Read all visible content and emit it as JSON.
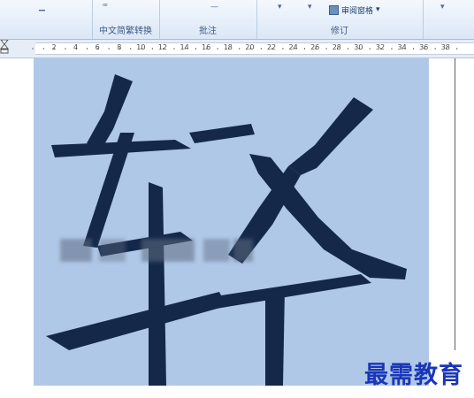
{
  "ribbon": {
    "groups": [
      {
        "id": "chinese",
        "label": "中文简繁转换"
      },
      {
        "id": "comments",
        "label": "批注"
      },
      {
        "id": "tracking",
        "label": "修订"
      }
    ],
    "tracking_button_label": "审阅窗格",
    "tracking_button_arrow": "▾"
  },
  "ruler": {
    "ticks": [
      "2",
      "4",
      "6",
      "8",
      "10",
      "12",
      "14",
      "16",
      "18",
      "20",
      "22",
      "24",
      "26",
      "28",
      "30",
      "32",
      "34",
      "36",
      "38"
    ]
  },
  "document": {
    "character": "轻"
  },
  "watermark": "最需教育",
  "colors": {
    "page_background": "#b0c8e8",
    "character_fill": "#14284a",
    "watermark": "#1a36b8"
  }
}
